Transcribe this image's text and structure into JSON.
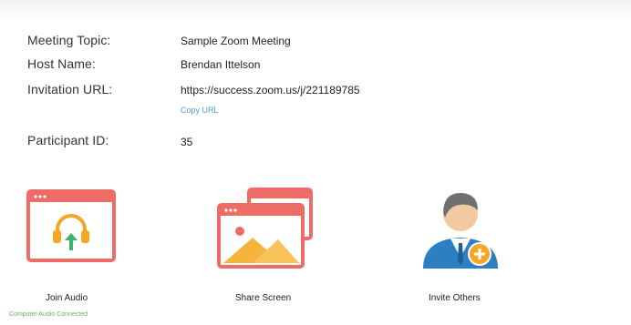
{
  "info": {
    "meeting_topic_label": "Meeting Topic:",
    "meeting_topic_value": "Sample Zoom Meeting",
    "host_name_label": "Host Name:",
    "host_name_value": "Brendan Ittelson",
    "invitation_url_label": "Invitation URL:",
    "invitation_url_value": "https://success.zoom.us/j/221189785",
    "copy_url_label": "Copy URL",
    "participant_id_label": "Participant ID:",
    "participant_id_value": "35"
  },
  "actions": {
    "join_audio_label": "Join Audio",
    "join_audio_status": "Computer Audio Connected",
    "share_screen_label": "Share Screen",
    "invite_others_label": "Invite Others"
  },
  "colors": {
    "icon_red": "#ef6b66",
    "icon_orange": "#f5a623",
    "icon_green": "#3cb371",
    "avatar_blue": "#2d7fc1",
    "link_blue": "#4a9fe0",
    "status_green": "#5fb85f"
  }
}
